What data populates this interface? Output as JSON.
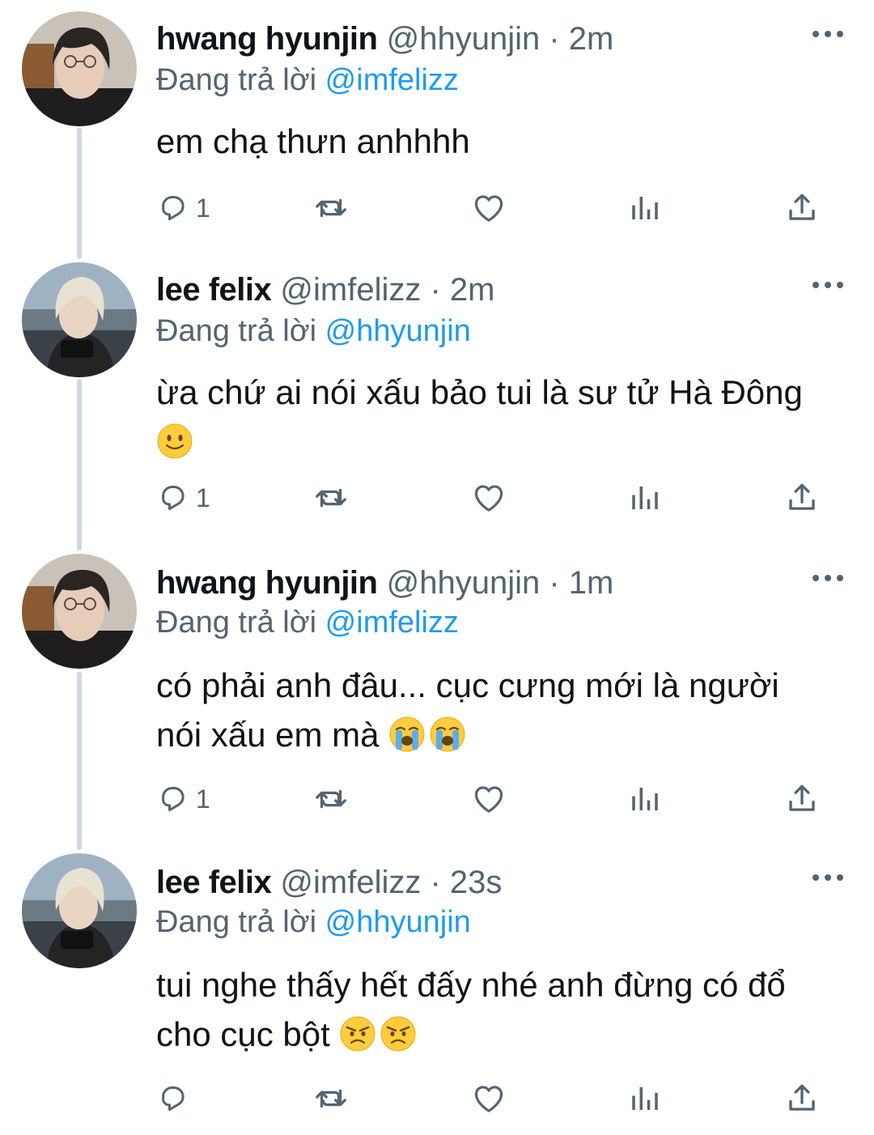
{
  "tweets": [
    {
      "name": "hwang hyunjin",
      "handle": "@hhyunjin",
      "sep": "·",
      "time": "2m",
      "reply_prefix": "Đang trả lời",
      "reply_to": "@imfelizz",
      "text": "em chạ thưn anhhhh",
      "emojis": [],
      "reply_count": "1"
    },
    {
      "name": "lee felix",
      "handle": "@imfelizz",
      "sep": "·",
      "time": "2m",
      "reply_prefix": "Đang trả lời",
      "reply_to": "@hhyunjin",
      "text_line1": "ừa chứ ai nói xấu bảo tui là sư tử Hà Đông",
      "emojis": [
        "slightly-smiling-face"
      ],
      "reply_count": "1"
    },
    {
      "name": "hwang hyunjin",
      "handle": "@hhyunjin",
      "sep": "·",
      "time": "1m",
      "reply_prefix": "Đang trả lời",
      "reply_to": "@imfelizz",
      "text_line1": "có phải anh đâu... cục cưng mới là người",
      "text_line2": "nói xấu em mà",
      "emojis": [
        "loudly-crying-face",
        "loudly-crying-face"
      ],
      "reply_count": "1"
    },
    {
      "name": "lee felix",
      "handle": "@imfelizz",
      "sep": "·",
      "time": "23s",
      "reply_prefix": "Đang trả lời",
      "reply_to": "@hhyunjin",
      "text_line1": "tui nghe thấy hết đấy nhé anh đừng có đổ",
      "text_line2": "cho cục bột",
      "emojis": [
        "angry-face",
        "angry-face"
      ],
      "reply_count": ""
    }
  ],
  "colors": {
    "text": "#0f1419",
    "secondary": "#536471",
    "link": "#1d9bf0",
    "thread_line": "#cfd9de"
  },
  "icons": {
    "reply": "reply-icon",
    "retweet": "retweet-icon",
    "like": "heart-icon",
    "views": "views-icon",
    "share": "share-icon",
    "more": "more-options-icon"
  }
}
